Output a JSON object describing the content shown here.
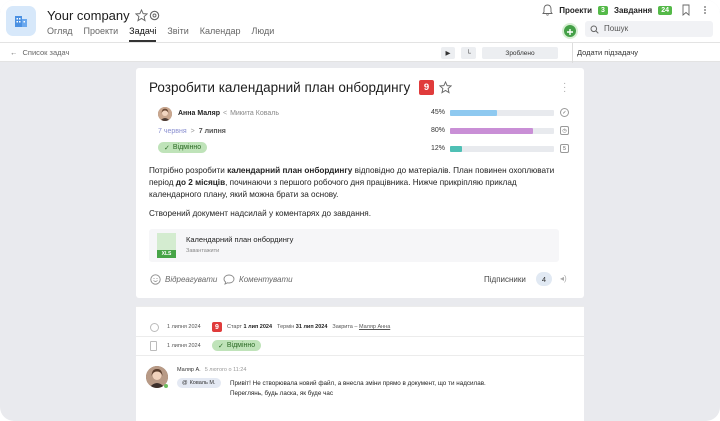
{
  "header": {
    "company": "Your company",
    "nav": [
      "Огляд",
      "Проекти",
      "Задачі",
      "Звіти",
      "Календар",
      "Люди"
    ],
    "projects_label": "Проекти",
    "projects_count": "3",
    "tasks_label": "Завдання",
    "tasks_count": "24",
    "search_placeholder": "Пошук"
  },
  "toolbar": {
    "back_label": "Список задач",
    "done_label": "Зроблено",
    "add_subtask_label": "Додати підзадачу"
  },
  "task": {
    "title": "Розробити календарний план онбордингу",
    "priority": "9",
    "assignee": "Анна Маляр",
    "coauthor": "Микита Коваль",
    "date_start": "7 червня",
    "date_end": "7 липня",
    "status": "Відмінно",
    "progress": [
      {
        "label": "45%",
        "value": 0.45,
        "color": "#8ec9f0",
        "icon": "check-circle-icon"
      },
      {
        "label": "80%",
        "value": 0.8,
        "color": "#c98fd6",
        "icon": "clock-icon"
      },
      {
        "label": "12%",
        "value": 0.12,
        "color": "#4fc0b5",
        "icon": "number-icon"
      }
    ],
    "progress_icon_text": [
      "",
      "",
      "5"
    ],
    "description_p1_a": "Потрібно розробити ",
    "description_p1_b": "календарний план онбордингу",
    "description_p1_c": " відповідно до матеріалів. План повинен охоплювати період ",
    "description_p1_d": "до 2 місяців",
    "description_p1_e": ", починаючи з першого робочого дня працівника. Нижче прикріпляю приклад календарного плану, який можна брати за основу.",
    "description_p2": "Створений документ надсилай у коментарях до завдання.",
    "attachment": {
      "name": "Календарний план онбордингу",
      "sub": "Завантажити",
      "type": "XLS"
    },
    "react_label": "Відреагувати",
    "comment_label": "Коментувати",
    "subscribers_label": "Підписники",
    "subscribers_count": "4"
  },
  "activity": {
    "row1": {
      "date": "1 липня 2024",
      "priority": "9",
      "start_label": "Старт",
      "start_value": "1 лип 2024",
      "term_label": "Термін",
      "term_value": "31 лип 2024",
      "closed_label": "Закрита –",
      "closed_by": "Маляр Анна"
    },
    "row2": {
      "date": "1 липня 2024",
      "status": "Відмінно"
    },
    "comment": {
      "author": "Маляр А.",
      "time": "5 лютого о 11:24",
      "mention": "Коваль М.",
      "line1": "Привіт! Не створювала новий файл, а внесла зміни прямо в документ, що ти надсилав.",
      "line2": "Переглянь, будь ласка, як буде час"
    }
  },
  "colors": {
    "accent_green": "#54b948",
    "priority_red": "#e03b3b",
    "status_green_bg": "#bfe3b9"
  }
}
